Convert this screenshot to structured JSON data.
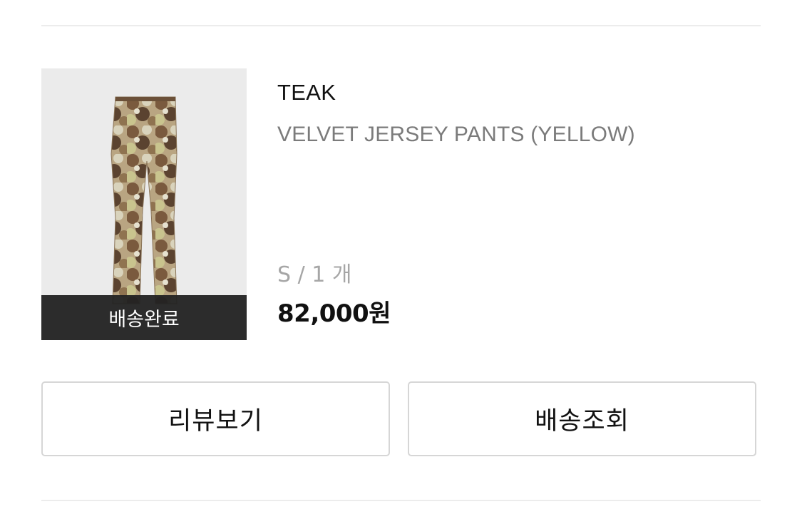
{
  "order_item": {
    "brand": "TEAK",
    "product_name": "VELVET JERSEY PANTS (YELLOW)",
    "option": "S / 1 개",
    "price": "82,000원",
    "status_badge": "배송완료",
    "thumbnail_icon": "pants-product-image"
  },
  "actions": {
    "review_label": "리뷰보기",
    "track_label": "배송조회"
  },
  "colors": {
    "status_band": "#222222",
    "option_text": "#a6a6a6",
    "name_text": "#7b7b7b",
    "button_border": "#d6d6d6"
  }
}
